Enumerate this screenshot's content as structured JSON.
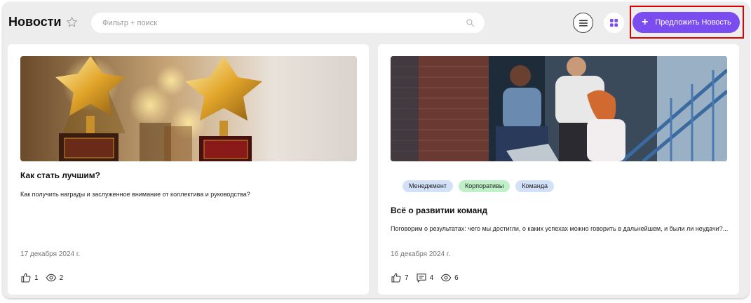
{
  "header": {
    "title": "Новости",
    "search_placeholder": "Фильтр + поиск",
    "propose_button": "Предложить Новость"
  },
  "colors": {
    "accent": "#7b4cf0",
    "highlight": "#e00000",
    "tag_blue": "#d2e1f8",
    "tag_green": "#bff0c7"
  },
  "news": [
    {
      "title": "Как стать лучшим?",
      "description": "Как получить награды и заслуженное внимание от коллектива и руководства?",
      "date": "17 декабря 2024 г.",
      "likes": "1",
      "views": "2",
      "tags": []
    },
    {
      "title": "Всё о развитии команд",
      "description": "Поговорим о результатах: чего мы достигли, о каких успехах можно говорить в дальнейшем, и были ли неудачи?...",
      "date": "16 декабря 2024 г.",
      "likes": "7",
      "comments": "4",
      "views": "6",
      "tags": [
        {
          "label": "Менеджмент",
          "color": "blue"
        },
        {
          "label": "Корпоративы",
          "color": "green"
        },
        {
          "label": "Команда",
          "color": "blue"
        }
      ]
    }
  ]
}
